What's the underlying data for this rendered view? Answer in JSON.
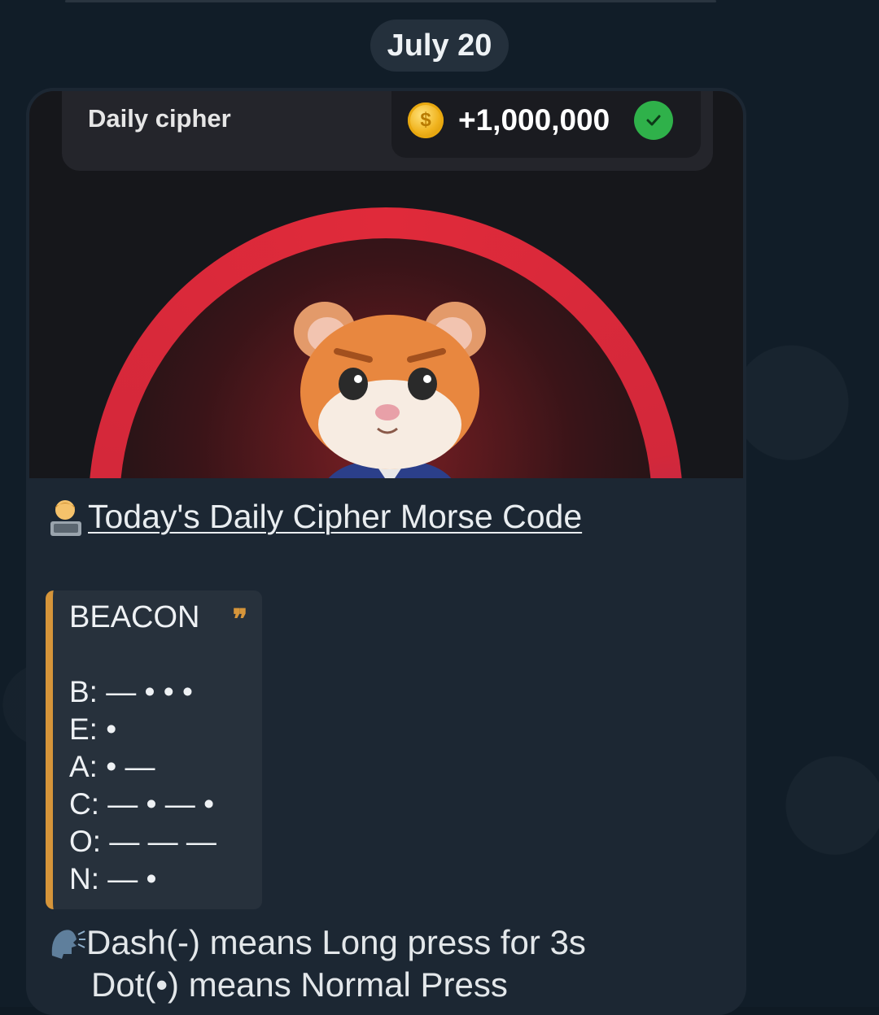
{
  "date_label": "July 20",
  "media": {
    "cipher_label": "Daily cipher",
    "reward_amount": "+1,000,000",
    "colors": {
      "arc": "#d3283a",
      "coin": "#f0b21c",
      "check": "#2fb14a"
    }
  },
  "message": {
    "title": "Today's Daily Cipher Morse Code",
    "quote": {
      "word": "BEACON",
      "morse": [
        "B: — • • •",
        "E: •",
        "A: • —",
        "C: — • — •",
        "O: — — —",
        "N: — •"
      ]
    },
    "note_line1": "Dash(-) means Long press for 3s",
    "note_line2": "Dot(•) means Normal Press"
  }
}
